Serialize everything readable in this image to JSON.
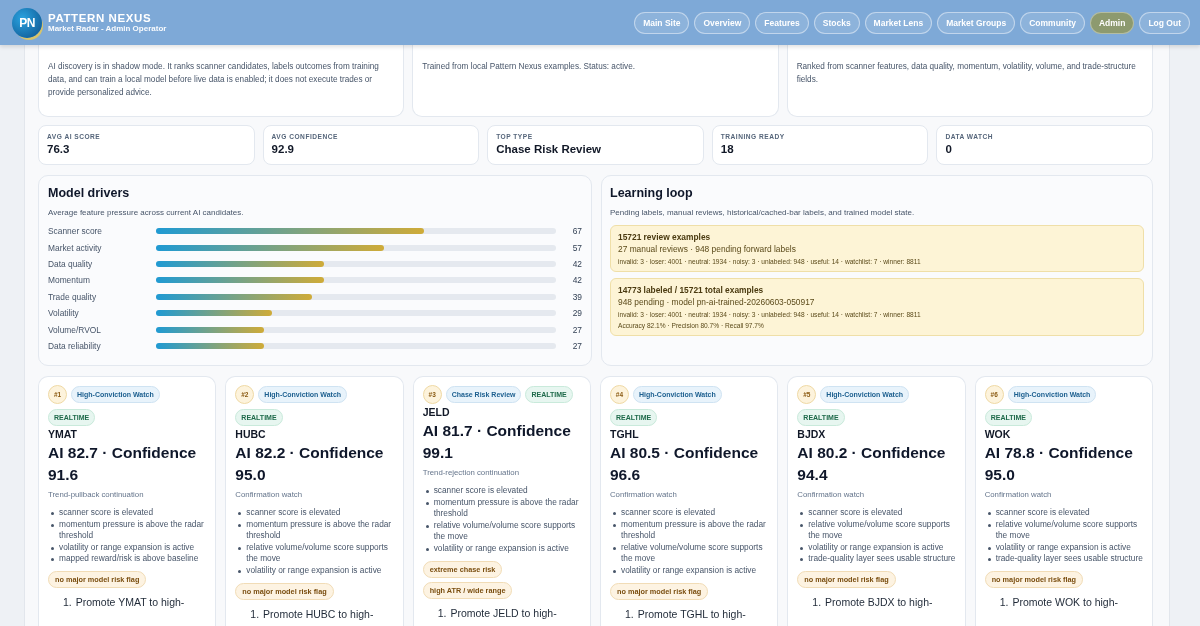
{
  "header": {
    "logo_text": "PN",
    "title": "PATTERN NEXUS",
    "subtitle": "Market Radar - Admin Operator",
    "nav": [
      {
        "label": "Main Site",
        "selected": false
      },
      {
        "label": "Overview",
        "selected": false
      },
      {
        "label": "Features",
        "selected": false
      },
      {
        "label": "Stocks",
        "selected": false
      },
      {
        "label": "Market Lens",
        "selected": false
      },
      {
        "label": "Market Groups",
        "selected": false
      },
      {
        "label": "Community",
        "selected": false
      },
      {
        "label": "Admin",
        "selected": true
      },
      {
        "label": "Log Out",
        "selected": false
      }
    ]
  },
  "summary_cards": [
    {
      "description": "AI discovery is in shadow mode. It ranks scanner candidates, labels outcomes from training data, and can train a local model before live data is enabled; it does not execute trades or provide personalized advice."
    },
    {
      "description": "Trained from local Pattern Nexus examples. Status: active."
    },
    {
      "description": "Ranked from scanner features, data quality, momentum, volatility, volume, and trade-structure fields."
    }
  ],
  "stats": [
    {
      "label": "AVG AI SCORE",
      "value": "76.3"
    },
    {
      "label": "AVG CONFIDENCE",
      "value": "92.9"
    },
    {
      "label": "TOP TYPE",
      "value": "Chase Risk Review"
    },
    {
      "label": "TRAINING READY",
      "value": "18"
    },
    {
      "label": "DATA WATCH",
      "value": "0"
    }
  ],
  "drivers": {
    "title": "Model drivers",
    "subtitle": "Average feature pressure across current AI candidates.",
    "rows": [
      {
        "name": "Scanner score",
        "level": 0.67,
        "value": "67"
      },
      {
        "name": "Market activity",
        "level": 0.57,
        "value": "57"
      },
      {
        "name": "Data quality",
        "level": 0.42,
        "value": "42"
      },
      {
        "name": "Momentum",
        "level": 0.42,
        "value": "42"
      },
      {
        "name": "Trade quality",
        "level": 0.39,
        "value": "39"
      },
      {
        "name": "Volatility",
        "level": 0.29,
        "value": "29"
      },
      {
        "name": "Volume/RVOL",
        "level": 0.27,
        "value": "27"
      },
      {
        "name": "Data reliability",
        "level": 0.27,
        "value": "27"
      }
    ]
  },
  "learning_loop": {
    "title": "Learning loop",
    "subtitle": "Pending labels, manual reviews, historical/cached-bar labels, and trained model state.",
    "boxes": [
      {
        "title": "15721 review examples",
        "line": "27 manual reviews · 948 pending forward labels",
        "details": [
          "invalid: 3 · loser: 4001 · neutral: 1934 · noisy: 3 · unlabeled: 948 · useful: 14 · watchlist: 7 · winner: 8811"
        ]
      },
      {
        "title": "14773 labeled / 15721 total examples",
        "line": "948 pending · model pn-ai-trained-20260603-050917",
        "details": [
          "invalid: 3 · loser: 4001 · neutral: 1934 · noisy: 3 · unlabeled: 948 · useful: 14 · watchlist: 7 · winner: 8811",
          "Accuracy 82.1% · Precision 80.7% · Recall 97.7%"
        ]
      }
    ]
  },
  "candidates": [
    {
      "rank": "#1",
      "tags": [
        {
          "text": "High-Conviction Watch",
          "kind": "type"
        },
        {
          "text": "REALTIME",
          "kind": "feed"
        }
      ],
      "ticker": "YMAT",
      "headline": "AI 82.7 · Confidence 91.6",
      "setup": "Trend-pullback continuation",
      "reasons": [
        "scanner score is elevated",
        "momentum pressure is above the radar threshold",
        "volatility or range expansion is active",
        "mapped reward/risk is above baseline"
      ],
      "flags": [
        "no major model risk flag"
      ],
      "steps": [
        {
          "number": "1.",
          "text": "Promote YMAT to high-"
        }
      ]
    },
    {
      "rank": "#2",
      "tags": [
        {
          "text": "High-Conviction Watch",
          "kind": "type"
        },
        {
          "text": "REALTIME",
          "kind": "feed"
        }
      ],
      "ticker": "HUBC",
      "headline": "AI 82.2 · Confidence 95.0",
      "setup": "Confirmation watch",
      "reasons": [
        "scanner score is elevated",
        "momentum pressure is above the radar threshold",
        "relative volume/volume score supports the move",
        "volatility or range expansion is active"
      ],
      "flags": [
        "no major model risk flag"
      ],
      "steps": [
        {
          "number": "1.",
          "text": "Promote HUBC to high-"
        }
      ]
    },
    {
      "rank": "#3",
      "tags": [
        {
          "text": "Chase Risk Review",
          "kind": "type"
        },
        {
          "text": "REALTIME",
          "kind": "feed"
        }
      ],
      "ticker": "JELD",
      "headline": "AI 81.7 · Confidence 99.1",
      "setup": "Trend-rejection continuation",
      "reasons": [
        "scanner score is elevated",
        "momentum pressure is above the radar threshold",
        "relative volume/volume score supports the move",
        "volatility or range expansion is active"
      ],
      "flags": [
        "extreme chase risk",
        "high ATR / wide range"
      ],
      "steps": [
        {
          "number": "1.",
          "text": "Promote JELD to high-"
        }
      ]
    },
    {
      "rank": "#4",
      "tags": [
        {
          "text": "High-Conviction Watch",
          "kind": "type"
        },
        {
          "text": "REALTIME",
          "kind": "feed"
        }
      ],
      "ticker": "TGHL",
      "headline": "AI 80.5 · Confidence 96.6",
      "setup": "Confirmation watch",
      "reasons": [
        "scanner score is elevated",
        "momentum pressure is above the radar threshold",
        "relative volume/volume score supports the move",
        "volatility or range expansion is active"
      ],
      "flags": [
        "no major model risk flag"
      ],
      "steps": [
        {
          "number": "1.",
          "text": "Promote TGHL to high-"
        }
      ]
    },
    {
      "rank": "#5",
      "tags": [
        {
          "text": "High-Conviction Watch",
          "kind": "type"
        },
        {
          "text": "REALTIME",
          "kind": "feed"
        }
      ],
      "ticker": "BJDX",
      "headline": "AI 80.2 · Confidence 94.4",
      "setup": "Confirmation watch",
      "reasons": [
        "scanner score is elevated",
        "relative volume/volume score supports the move",
        "volatility or range expansion is active",
        "trade-quality layer sees usable structure"
      ],
      "flags": [
        "no major model risk flag"
      ],
      "steps": [
        {
          "number": "1.",
          "text": "Promote BJDX to high-"
        }
      ]
    },
    {
      "rank": "#6",
      "tags": [
        {
          "text": "High-Conviction Watch",
          "kind": "type"
        },
        {
          "text": "REALTIME",
          "kind": "feed"
        }
      ],
      "ticker": "WOK",
      "headline": "AI 78.8 · Confidence 95.0",
      "setup": "Confirmation watch",
      "reasons": [
        "scanner score is elevated",
        "relative volume/volume score supports the move",
        "volatility or range expansion is active",
        "trade-quality layer sees usable structure"
      ],
      "flags": [
        "no major model risk flag"
      ],
      "steps": [
        {
          "number": "1.",
          "text": "Promote WOK to high-"
        }
      ]
    }
  ]
}
